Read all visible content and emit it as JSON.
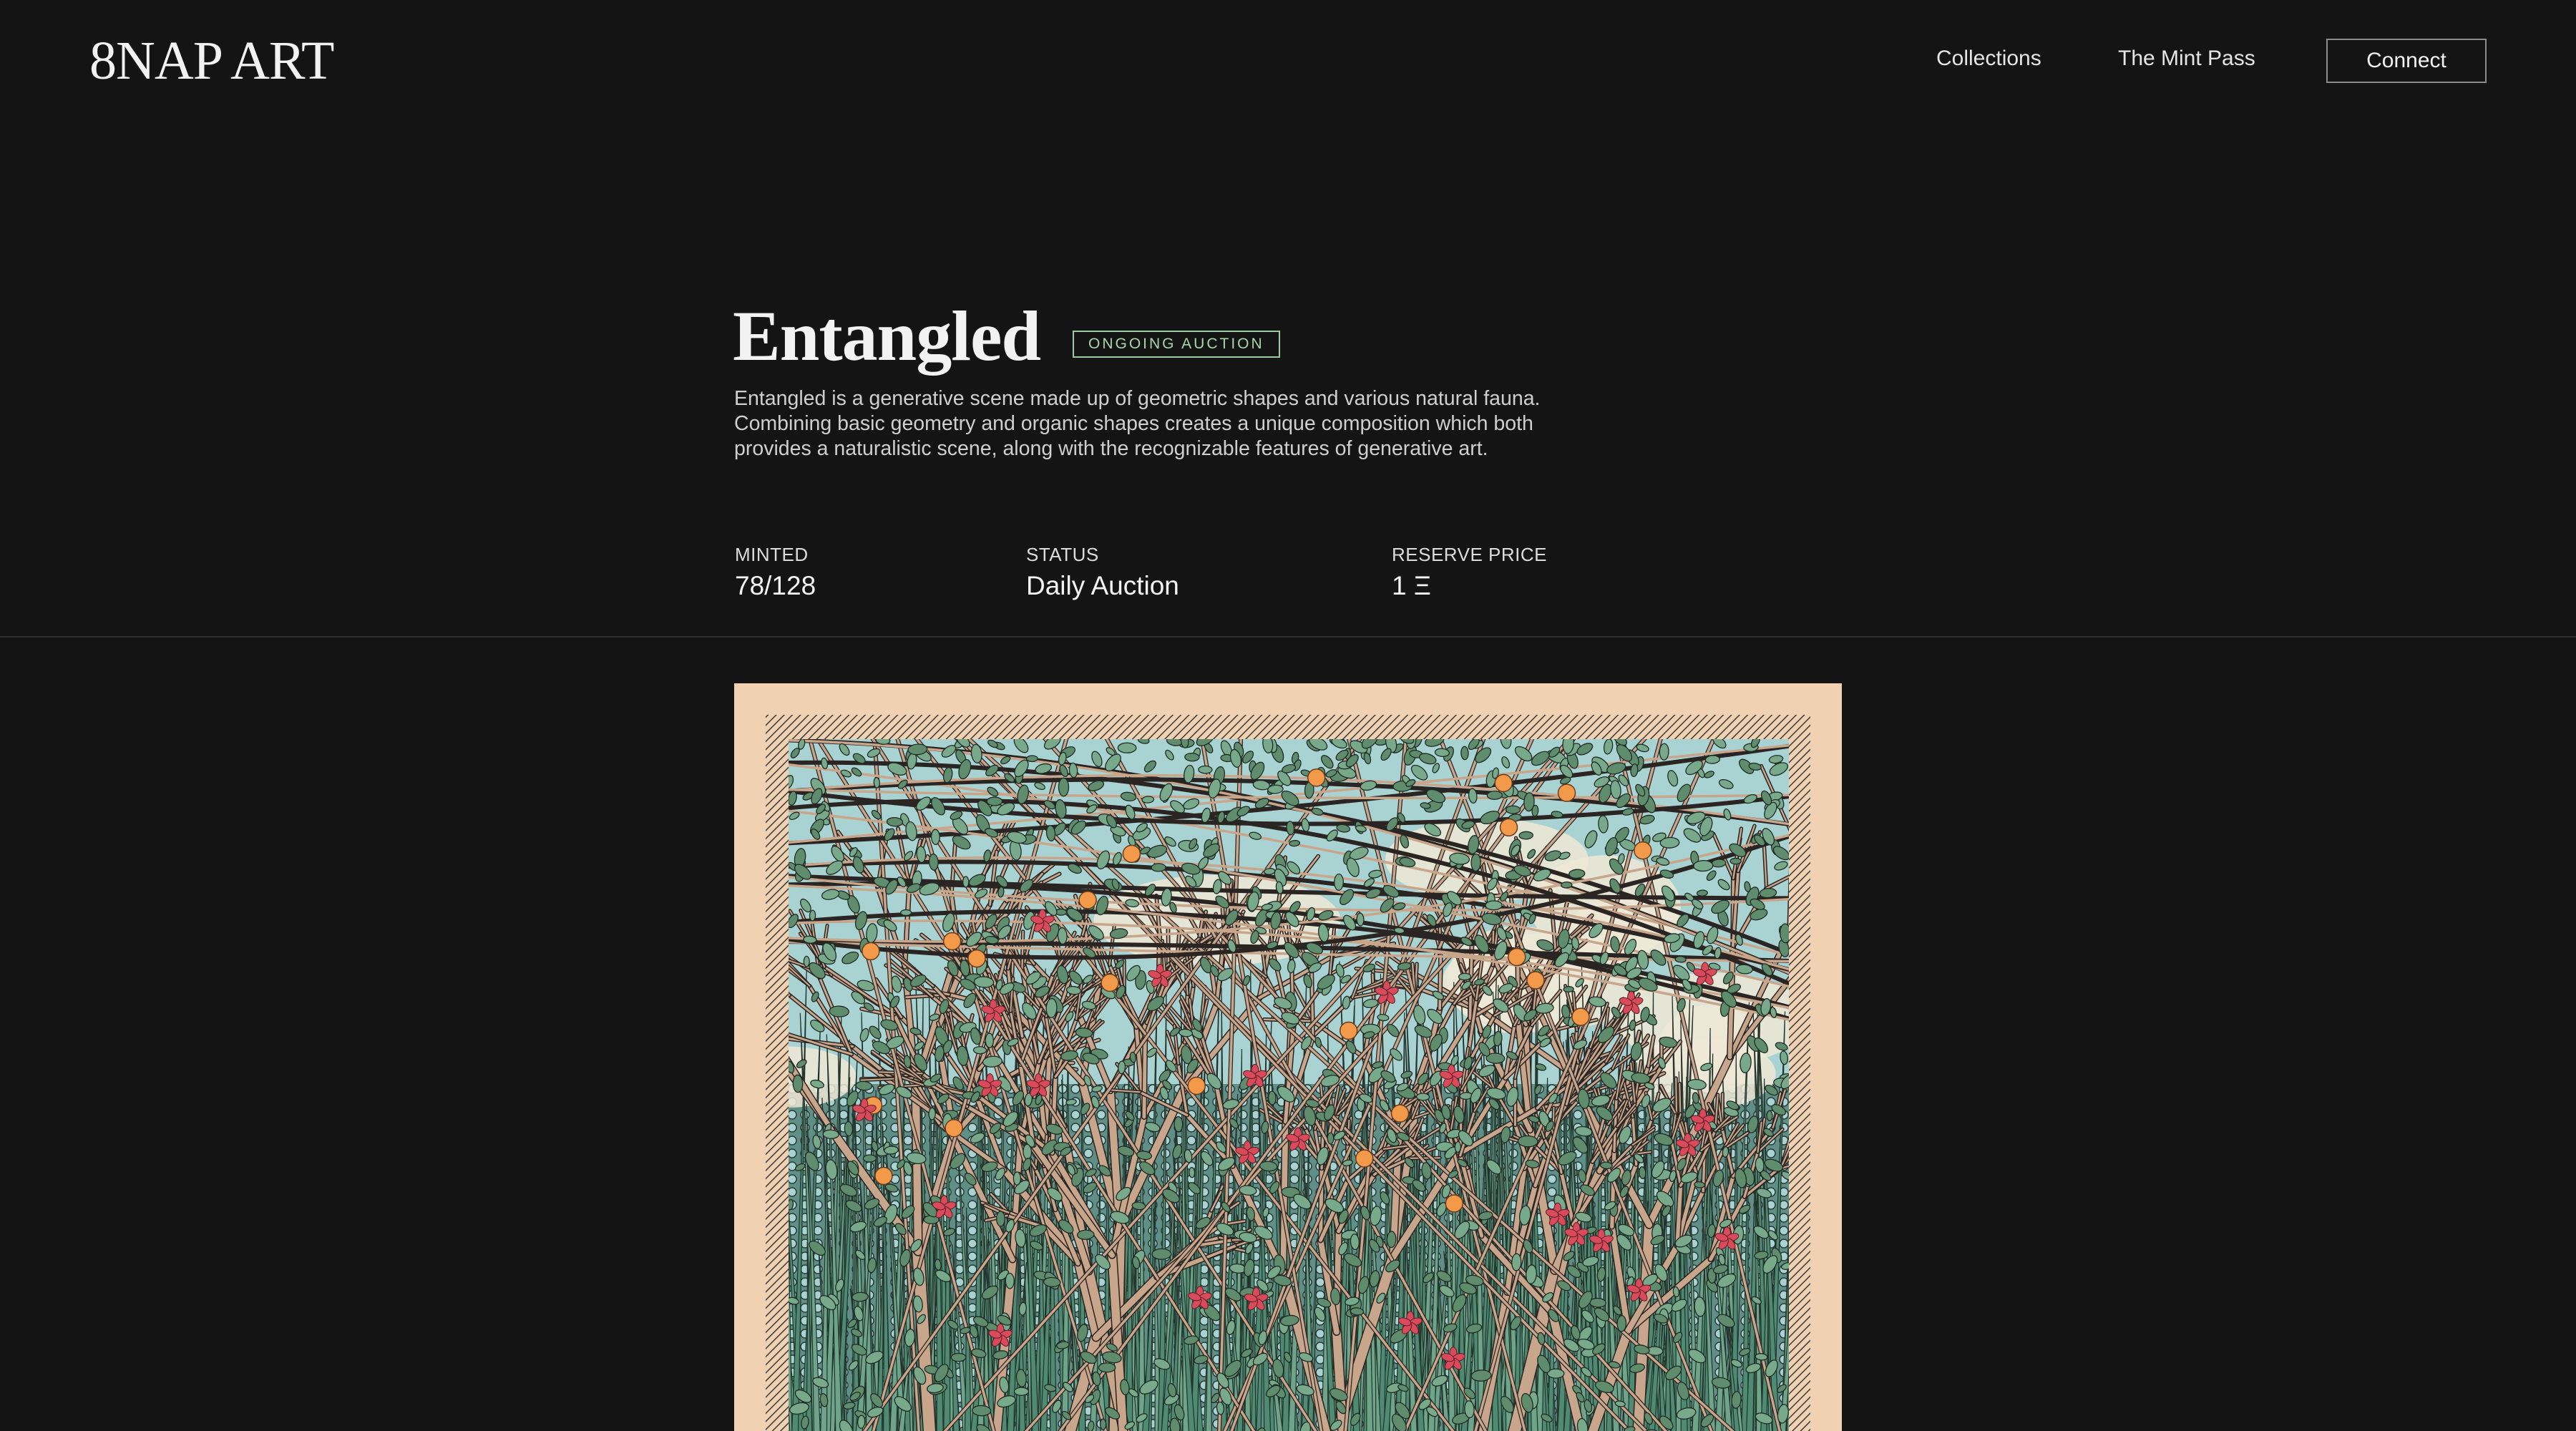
{
  "header": {
    "logo": "8NAP ART",
    "nav": [
      {
        "label": "Collections"
      },
      {
        "label": "The Mint Pass"
      }
    ],
    "connect_label": "Connect"
  },
  "collection": {
    "title": "Entangled",
    "badge": "ONGOING AUCTION",
    "description": "Entangled is a generative scene made up of geometric shapes and various natural fauna. Combining basic geometry and organic shapes creates a unique composition which both provides a naturalistic scene, along with the recognizable features of generative art.",
    "stats": [
      {
        "label": "MINTED",
        "value": "78/128"
      },
      {
        "label": "STATUS",
        "value": "Daily Auction"
      },
      {
        "label": "RESERVE PRICE",
        "value": "1 Ξ"
      }
    ]
  },
  "colors": {
    "background": "#141414",
    "badge_green": "#a8d6ac",
    "art_frame": "#f0d2b2",
    "art_leaf": "#5e8c6d",
    "art_branch": "#c8a68c",
    "art_fruit": "#f2994a",
    "art_flower": "#d94a5a",
    "art_sky": "#a9d3d2"
  }
}
